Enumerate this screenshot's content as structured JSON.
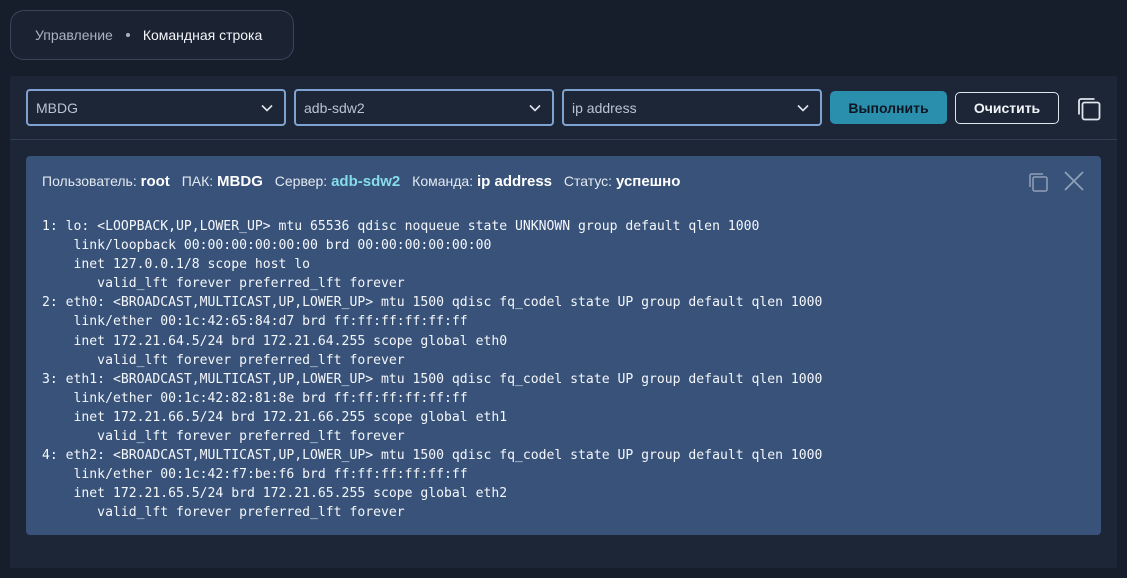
{
  "breadcrumb": {
    "parent": "Управление",
    "current": "Командная строка"
  },
  "toolbar": {
    "pak_select": {
      "value": "MBDG"
    },
    "server_select": {
      "value": "adb-sdw2"
    },
    "command_select": {
      "value": "ip address"
    },
    "run_label": "Выполнить",
    "clear_label": "Очистить"
  },
  "result": {
    "user_label": "Пользователь:",
    "user_value": "root",
    "pak_label": "ПАК:",
    "pak_value": "MBDG",
    "server_label": "Сервер:",
    "server_value": "adb-sdw2",
    "command_label": "Команда:",
    "command_value": "ip address",
    "status_label": "Статус:",
    "status_value": "успешно",
    "output": "1: lo: <LOOPBACK,UP,LOWER_UP> mtu 65536 qdisc noqueue state UNKNOWN group default qlen 1000\n    link/loopback 00:00:00:00:00:00 brd 00:00:00:00:00:00\n    inet 127.0.0.1/8 scope host lo\n       valid_lft forever preferred_lft forever\n2: eth0: <BROADCAST,MULTICAST,UP,LOWER_UP> mtu 1500 qdisc fq_codel state UP group default qlen 1000\n    link/ether 00:1c:42:65:84:d7 brd ff:ff:ff:ff:ff:ff\n    inet 172.21.64.5/24 brd 172.21.64.255 scope global eth0\n       valid_lft forever preferred_lft forever\n3: eth1: <BROADCAST,MULTICAST,UP,LOWER_UP> mtu 1500 qdisc fq_codel state UP group default qlen 1000\n    link/ether 00:1c:42:82:81:8e brd ff:ff:ff:ff:ff:ff\n    inet 172.21.66.5/24 brd 172.21.66.255 scope global eth1\n       valid_lft forever preferred_lft forever\n4: eth2: <BROADCAST,MULTICAST,UP,LOWER_UP> mtu 1500 qdisc fq_codel state UP group default qlen 1000\n    link/ether 00:1c:42:f7:be:f6 brd ff:ff:ff:ff:ff:ff\n    inet 172.21.65.5/24 brd 172.21.65.255 scope global eth2\n       valid_lft forever preferred_lft forever"
  },
  "icons": {
    "chevron": "chevron-down-icon",
    "copy": "copy-icon",
    "close": "close-icon"
  },
  "colors": {
    "background": "#161d2b",
    "panel": "#1d2636",
    "select_border": "#7fa3d1",
    "run_button": "#2a8fac",
    "result_card": "#385279",
    "server_accent": "#86dde9"
  }
}
